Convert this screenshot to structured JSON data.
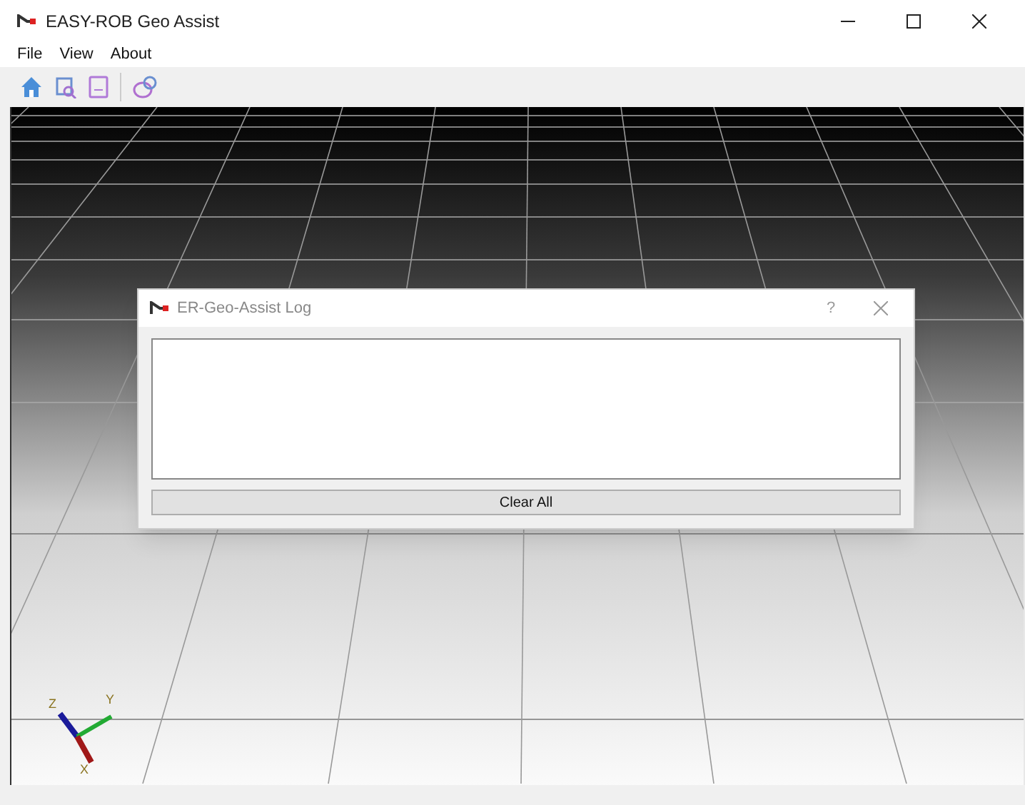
{
  "window": {
    "title": "EASY-ROB Geo Assist"
  },
  "menu": [
    "File",
    "View",
    "About"
  ],
  "viewport": {
    "axes": {
      "z": "Z",
      "y": "Y",
      "x": "X"
    }
  },
  "dialog": {
    "title": "ER-Geo-Assist Log",
    "help": "?",
    "button": "Clear All"
  }
}
